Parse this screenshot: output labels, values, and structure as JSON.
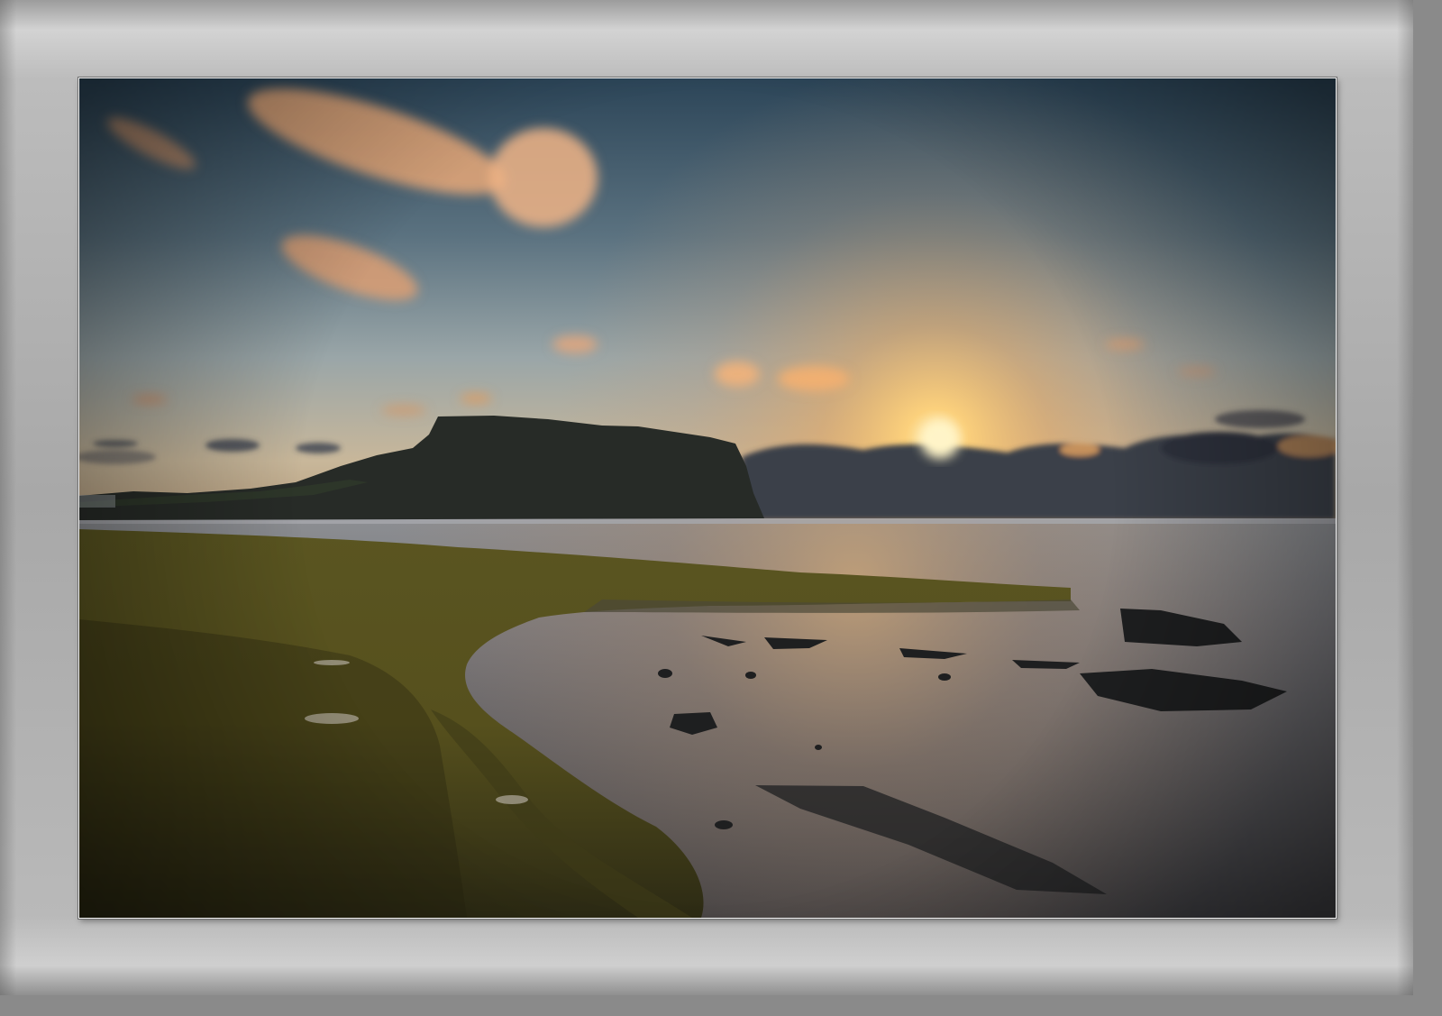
{
  "scene": {
    "subject": "seascape-at-sunrise",
    "colors": {
      "frame": "#a8a8a8",
      "sky_top": "#2f4a5e",
      "sky_glow": "#f2b660",
      "sun": "#fff0b8",
      "headland": "#2a2f2a",
      "moss": "#6b6420",
      "water": "#6e6a66"
    }
  }
}
